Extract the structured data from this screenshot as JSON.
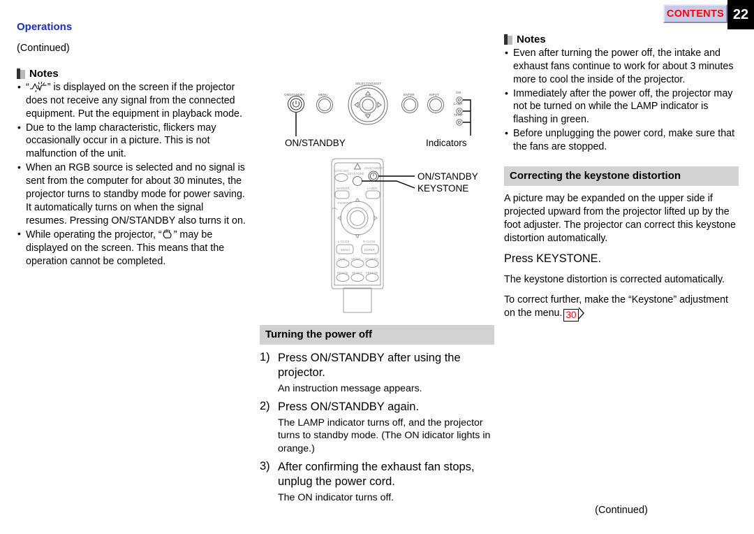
{
  "header": {
    "contents_label": "CONTENTS",
    "page_number": "22"
  },
  "left_column": {
    "section_title": "Operations",
    "continued_label": "(Continued)",
    "notes_title": "Notes",
    "notes": [
      "“        ” is displayed on the screen if the projector does not receive any signal from the connected equipment. Put the equipment in playback mode.",
      "Due to the lamp characteristic, flickers may occasionally occur in a picture. This is not malfunction of the unit.",
      "When an RGB source is selected and no signal is sent from the computer for about 30 minutes, the projector turns to standby mode for power saving. It automatically turns on when the signal resumes. Pressing ON/STANDBY also turns it on.",
      "While operating the projector, “      ” may be displayed on the screen. This means that the operation cannot be completed."
    ],
    "note1_parts": {
      "pre": "“",
      "mid": "” is displayed on the screen if the projector does not receive any signal from the connected equipment. Put the equipment in playback mode."
    },
    "note4_parts": {
      "pre": "While operating the projector, “",
      "post": "” may be displayed on the screen. This means that the operation cannot be completed."
    }
  },
  "middle_column": {
    "panel_diagram": {
      "button_labels": [
        "ON/STANDBY",
        "MENU",
        "SELECT/ADJUST",
        "ENTER",
        "INPUT"
      ],
      "indicator_labels": [
        "ON",
        "LAMP",
        "TEMP"
      ],
      "callout_left": "ON/STANDBY",
      "callout_right": "Indicators"
    },
    "remote_diagram": {
      "button_labels": [
        "AUTO SET",
        "KEYSTONE",
        "ON/STANDBY",
        "MARKER",
        "LASER",
        "POINTER",
        "PAL",
        "L-CLICK",
        "MENU",
        "R-CLICK",
        "ENTER",
        "RGB",
        "VIDEO",
        "CAMERA",
        "RESIZE",
        "RESET",
        "FREEZE"
      ],
      "callouts": [
        "ON/STANDBY",
        "KEYSTONE"
      ]
    },
    "section_bar": "Turning the power off",
    "steps": [
      {
        "num": "1)",
        "main": "Press ON/STANDBY after using the projector.",
        "sub": "An instruction message appears."
      },
      {
        "num": "2)",
        "main": "Press ON/STANDBY again.",
        "sub": "The LAMP indicator turns off, and the projector turns to standby mode. (The ON idicator lights in orange.)"
      },
      {
        "num": "3)",
        "main": "After confirming the exhaust fan stops, unplug the power cord.",
        "sub": "The ON indicator turns off."
      }
    ]
  },
  "right_column": {
    "notes_title": "Notes",
    "notes": [
      "Even after turning the power off, the intake and exhaust fans continue to work for about 3 minutes more to cool the inside of the projector.",
      "Immediately after the power off, the projector may not be turned on while the LAMP indicator is flashing in green.",
      "Before unplugging the power cord, make sure that the fans are stopped."
    ],
    "section_bar": "Correcting the keystone distortion",
    "paragraphs": [
      "A picture may be expanded on the upper side if projected upward from the projector lifted up by the foot adjuster. The projector can correct this keystone distortion automatically.",
      "The keystone distortion is corrected automatically."
    ],
    "press_line": "Press KEYSTONE.",
    "final_paragraph_pre": "To correct further, make the “Keystone” adjustment on the menu.",
    "page_ref": "30",
    "continued_label": "(Continued)"
  },
  "colors": {
    "section_title": "#1a2fb5",
    "bar_background": "#d2d2d2",
    "contents_background": "#c8cbe8",
    "contents_text": "#ff0000",
    "page_box": "#000000",
    "page_ref_text": "#ff0000"
  }
}
